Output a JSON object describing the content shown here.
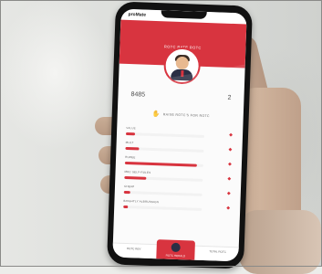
{
  "app": {
    "brand": "proMate",
    "brand_sub": "",
    "header_title": "ROTC RATE ROTC",
    "stats": {
      "left": "8485",
      "right": "2"
    },
    "action_label": "RAISE ROTC'S FOR ROTC",
    "metrics": [
      {
        "label": "VALUE",
        "level": 0.12
      },
      {
        "label": "MULT",
        "level": 0.18
      },
      {
        "label": "RUPEE",
        "level": 0.92
      },
      {
        "label": "MEC SELF-RULES",
        "level": 0.28
      },
      {
        "label": "CHEAP",
        "level": 0.08
      },
      {
        "label": "BRIGHTLY ALBRUSSION",
        "level": 0.06
      }
    ],
    "tabs": {
      "left": "ROTC REV",
      "center": "ROTC HERALD",
      "right": "TOTAL ROTC"
    }
  },
  "colors": {
    "accent": "#d8343f"
  },
  "icons": [
    "hand-icon",
    "metric-icon",
    "avatar-icon"
  ]
}
